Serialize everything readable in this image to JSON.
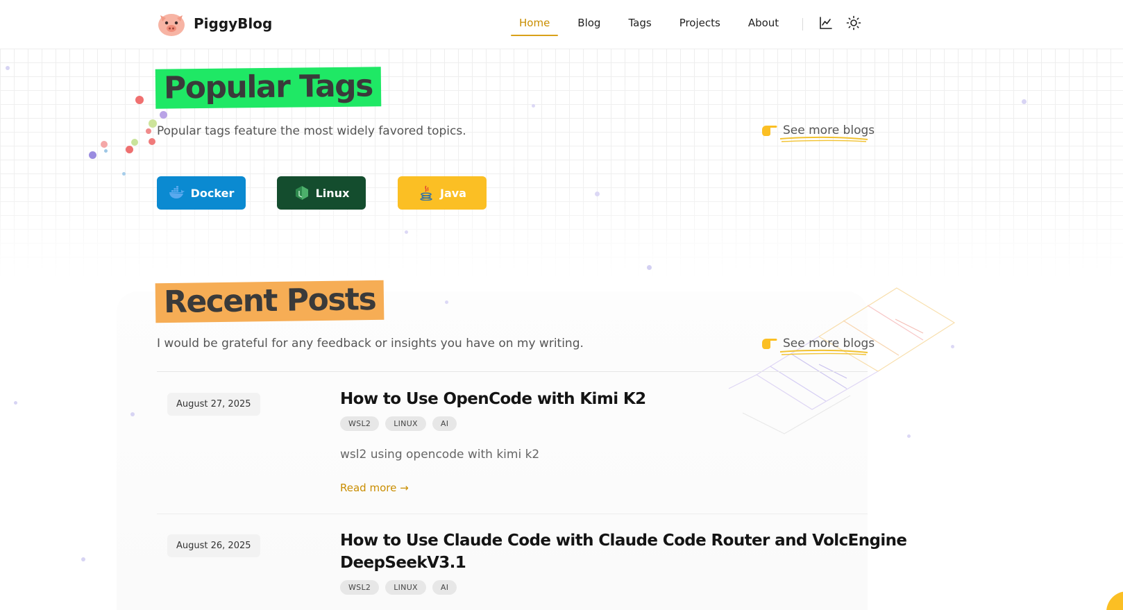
{
  "header": {
    "brand": "PiggyBlog",
    "nav": [
      "Home",
      "Blog",
      "Tags",
      "Projects",
      "About"
    ],
    "active_nav": "Home",
    "accent": "#d9a019",
    "icons": [
      "chart-icon",
      "sun-icon"
    ]
  },
  "popular_tags": {
    "title": "Popular Tags",
    "subtitle": "Popular tags feature the most widely favored topics.",
    "see_more": "See more blogs",
    "highlight_color": "#1fe865",
    "tags": [
      {
        "label": "Docker",
        "color": "#0b8ad1",
        "icon": "docker-icon"
      },
      {
        "label": "Linux",
        "color": "#144d2e",
        "icon": "linux-icon"
      },
      {
        "label": "Java",
        "color": "#fbbf24",
        "icon": "java-icon"
      }
    ]
  },
  "recent_posts": {
    "title": "Recent Posts",
    "subtitle": "I would be grateful for any feedback or insights you have on my writing.",
    "see_more": "See more blogs",
    "highlight_color": "#f6ad55",
    "posts": [
      {
        "date": "August 27, 2025",
        "title": "How to Use OpenCode with Kimi K2",
        "tags": [
          "WSL2",
          "LINUX",
          "AI"
        ],
        "description": "wsl2 using opencode with kimi k2",
        "read_more": "Read more →"
      },
      {
        "date": "August 26, 2025",
        "title_line1": "How to Use Claude Code with Claude Code Router and VolcEngine",
        "title_line2": "DeepSeekV3.1",
        "tags": [
          "WSL2",
          "LINUX",
          "AI"
        ]
      }
    ]
  }
}
